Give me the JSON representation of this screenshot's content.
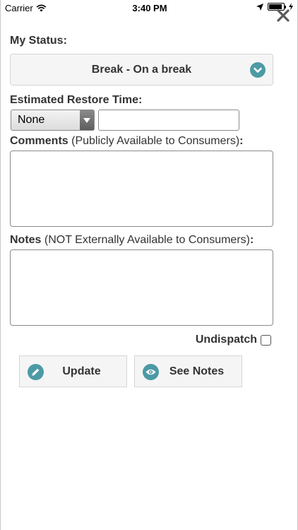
{
  "status_bar": {
    "carrier": "Carrier",
    "time": "3:40 PM"
  },
  "form": {
    "my_status_label": "My Status:",
    "status_value": "Break - On a break",
    "restore_time_label": "Estimated Restore Time:",
    "restore_time_value": "None",
    "restore_time_text": "",
    "comments_label_bold": "Comments",
    "comments_label_rest": " (Publicly Available to Consumers)",
    "comments_colon": ":",
    "notes_label_bold": "Notes",
    "notes_label_rest": " (NOT Externally Available to Consumers)",
    "notes_colon": ":",
    "undispatch_label": "Undispatch"
  },
  "buttons": {
    "update_label": "Update",
    "see_notes_label": "See Notes"
  },
  "colors": {
    "accent": "#4c9aa5"
  },
  "icons": {
    "status_chevron": "chevron-down-icon",
    "update": "pencil-icon",
    "see_notes": "eye-icon",
    "close": "close-icon"
  }
}
